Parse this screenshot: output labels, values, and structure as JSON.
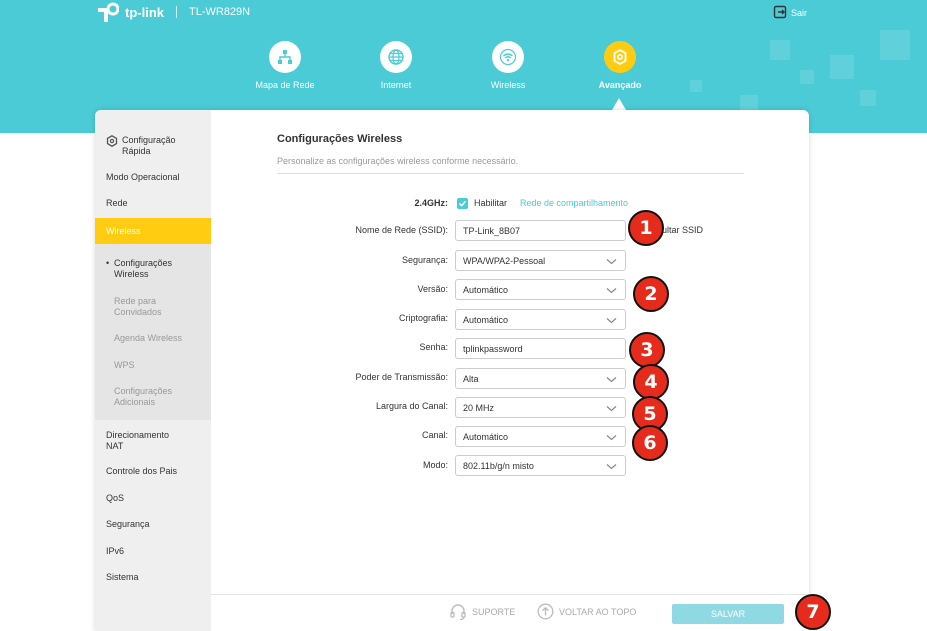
{
  "header": {
    "brand": "tp-link",
    "model": "TL-WR829N",
    "logout_label": "Sair",
    "nav": [
      {
        "label": "Mapa de Rede",
        "icon": "network-map-icon"
      },
      {
        "label": "Internet",
        "icon": "globe-icon"
      },
      {
        "label": "Wireless",
        "icon": "wifi-icon"
      },
      {
        "label": "Avançado",
        "icon": "gear-icon",
        "active": true
      }
    ]
  },
  "sidebar": {
    "quick_setup": "Configuração Rápida",
    "items": [
      "Modo Operacional",
      "Rede",
      "Wireless",
      "Direcionamento NAT",
      "Controle dos Pais",
      "QoS",
      "Segurança",
      "IPv6",
      "Sistema"
    ],
    "active_item": "Wireless",
    "subitems": [
      "Configurações Wireless",
      "Rede para Convidados",
      "Agenda Wireless",
      "WPS",
      "Configurações Adicionais"
    ]
  },
  "main": {
    "title": "Configurações Wireless",
    "subtitle": "Personalize as configurações wireless conforme necessário.",
    "band_label": "2.4GHz:",
    "enable_label": "Habilitar",
    "sharing_link": "Rede de compartilhamento",
    "hide_ssid_partial": "ultar SSID",
    "fields": {
      "ssid": {
        "label": "Nome de Rede (SSID):",
        "value": "TP-Link_8B07"
      },
      "security": {
        "label": "Segurança:",
        "value": "WPA/WPA2-Pessoal"
      },
      "version": {
        "label": "Versão:",
        "value": "Automático"
      },
      "encryption": {
        "label": "Criptografia:",
        "value": "Automático"
      },
      "password": {
        "label": "Senha:",
        "value": "tplinkpassword"
      },
      "tx_power": {
        "label": "Poder de Transmissão:",
        "value": "Alta"
      },
      "bandwidth": {
        "label": "Largura do Canal:",
        "value": "20 MHz"
      },
      "channel": {
        "label": "Canal:",
        "value": "Automático"
      },
      "mode": {
        "label": "Modo:",
        "value": "802.11b/g/n misto"
      }
    }
  },
  "markers": [
    "1",
    "2",
    "3",
    "4",
    "5",
    "6",
    "7"
  ],
  "footer": {
    "support": "SUPORTE",
    "back_to_top": "VOLTAR AO TOPO",
    "save": "SALVAR"
  },
  "colors": {
    "accent": "#4acbd6",
    "active": "#ffcc11",
    "marker": "#e52b1c"
  }
}
